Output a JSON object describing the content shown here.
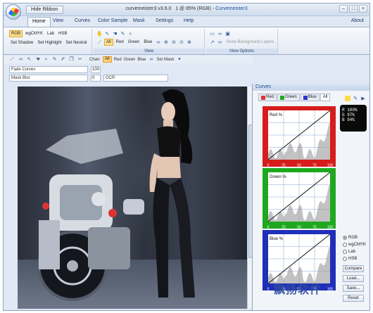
{
  "title_bar": {
    "hide_ribbon": "Hide Ribbon",
    "title": "curvemeister3 v3.6.0",
    "status": "1 @ 85% (RGB) - ",
    "app_name": "Curvemeister3"
  },
  "tabs": [
    {
      "label": "Home",
      "active": true
    },
    {
      "label": "View"
    },
    {
      "label": "Curves"
    },
    {
      "label": "Color Sample"
    },
    {
      "label": "Mask"
    },
    {
      "label": "Settings"
    },
    {
      "label": "Help"
    }
  ],
  "about": "About",
  "ribbon": {
    "modes": [
      "RGB",
      "wgCMYK",
      "Lab",
      "HSB"
    ],
    "actions": [
      "Set Shadow",
      "Set Highlight",
      "Set Neutral"
    ],
    "channels": [
      "All",
      "Red",
      "Green",
      "Blue"
    ],
    "view_caption": "View",
    "options_caption": "View Options",
    "show_background_layers": "Show Background Layers"
  },
  "toolbar": {
    "channel_label": "Chan:",
    "channels": [
      "All",
      "Red",
      "Green",
      "Blue"
    ],
    "set_mask": "Set Mask"
  },
  "sliders": {
    "fade_curves": "Fade Curves",
    "fade_value": "100",
    "mask_blur": "Mask Blur",
    "mask_blur_value": "0",
    "gcr": "GCR"
  },
  "curves_panel": {
    "header": "Curves",
    "tabs": [
      "Red",
      "Green",
      "Blue",
      "All"
    ],
    "charts": [
      {
        "label": "Red %",
        "color": "#d61c1c"
      },
      {
        "label": "Green %",
        "color": "#1fa81f"
      },
      {
        "label": "Blue %",
        "color": "#1f2fb8"
      }
    ],
    "axis_ticks": [
      "0",
      "25",
      "50",
      "75",
      "100"
    ],
    "readout": [
      "R 100%",
      "G  97%",
      "B  94%"
    ],
    "modes": [
      {
        "label": "RGB",
        "checked": true
      },
      {
        "label": "wgCMYK"
      },
      {
        "label": "Lab"
      },
      {
        "label": "HSB"
      }
    ],
    "buttons": [
      "Compare",
      "Load...",
      "Save...",
      "Reset"
    ]
  },
  "watermark": "飘扬软件"
}
